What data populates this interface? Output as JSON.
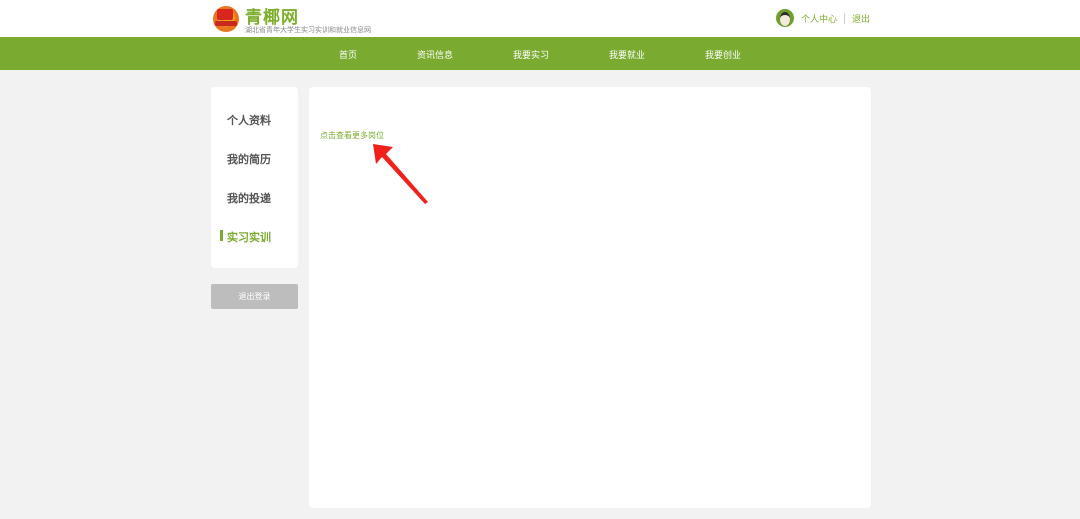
{
  "header": {
    "site_name": "青椰网",
    "site_subtitle": "湖北省青年大学生实习实训和就业信息网",
    "user_center": "个人中心",
    "logout": "退出"
  },
  "nav": {
    "items": [
      "首页",
      "资讯信息",
      "我要实习",
      "我要就业",
      "我要创业"
    ]
  },
  "sidebar": {
    "items": [
      {
        "label": "个人资料",
        "active": false
      },
      {
        "label": "我的简历",
        "active": false
      },
      {
        "label": "我的投递",
        "active": false
      },
      {
        "label": "实习实训",
        "active": true
      }
    ],
    "logout_button": "退出登录"
  },
  "main": {
    "more_positions_link": "点击查看更多岗位"
  },
  "colors": {
    "brand_green": "#7aab30",
    "annotation_red": "#f0201c"
  },
  "icons": [
    "emblem-logo-icon",
    "user-avatar-icon",
    "red-arrow-annotation-icon"
  ]
}
